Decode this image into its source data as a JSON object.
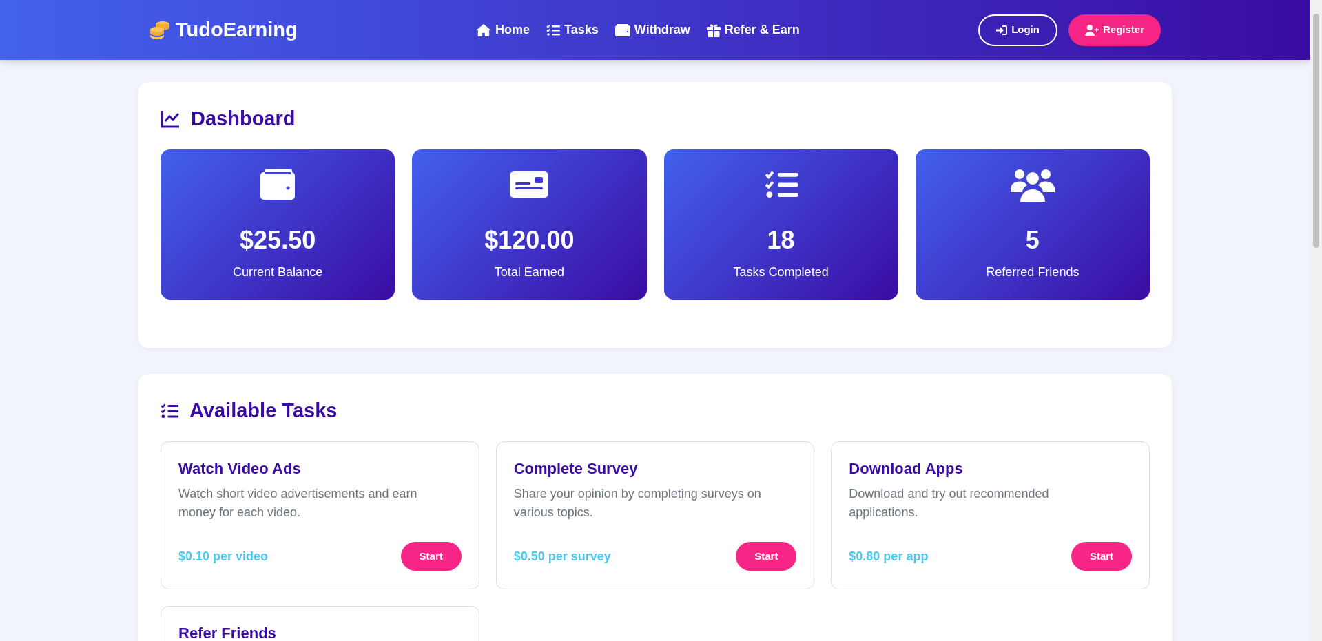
{
  "navbar": {
    "brand": "TudoEarning",
    "links": [
      {
        "label": "Home"
      },
      {
        "label": "Tasks"
      },
      {
        "label": "Withdraw"
      },
      {
        "label": "Refer & Earn"
      }
    ],
    "buttons": [
      {
        "kind": "outline",
        "label": "Login"
      },
      {
        "kind": "solid",
        "label": "Register"
      }
    ]
  },
  "dashboard": {
    "title": "Dashboard",
    "stats": [
      {
        "value": "$25.50",
        "label": "Current Balance"
      },
      {
        "value": "$120.00",
        "label": "Total Earned"
      },
      {
        "value": "18",
        "label": "Tasks Completed"
      },
      {
        "value": "5",
        "label": "Referred Friends"
      }
    ]
  },
  "tasks": {
    "title": "Available Tasks",
    "items": [
      {
        "title": "Watch Video Ads",
        "description": "Watch short video advertisements and earn money for each video.",
        "reward": "$0.10 per video",
        "button": "Start"
      },
      {
        "title": "Complete Survey",
        "description": "Share your opinion by completing surveys on various topics.",
        "reward": "$0.50 per survey",
        "button": "Start"
      },
      {
        "title": "Download Apps",
        "description": "Download and try out recommended applications.",
        "reward": "$0.80 per app",
        "button": "Start"
      },
      {
        "title": "Refer Friends"
      }
    ]
  }
}
